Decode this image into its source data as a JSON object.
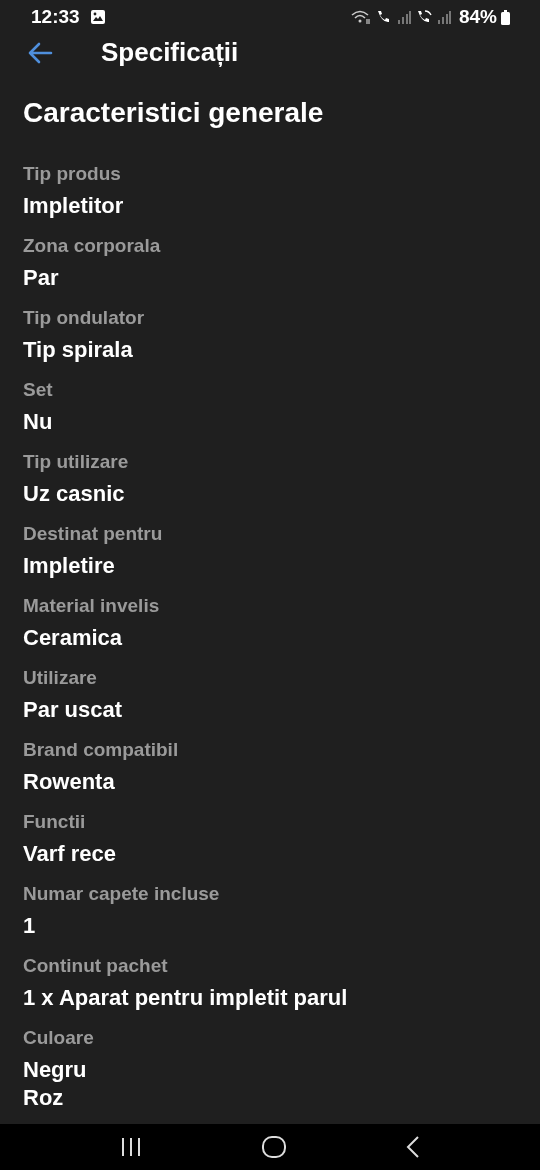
{
  "status_bar": {
    "time": "12:33",
    "battery": "84%"
  },
  "header": {
    "title": "Specificații"
  },
  "section": {
    "title": "Caracteristici generale"
  },
  "specs": [
    {
      "label": "Tip produs",
      "values": [
        "Impletitor"
      ]
    },
    {
      "label": "Zona corporala",
      "values": [
        "Par"
      ]
    },
    {
      "label": "Tip ondulator",
      "values": [
        "Tip spirala"
      ]
    },
    {
      "label": "Set",
      "values": [
        "Nu"
      ]
    },
    {
      "label": "Tip utilizare",
      "values": [
        "Uz casnic"
      ]
    },
    {
      "label": "Destinat pentru",
      "values": [
        "Impletire"
      ]
    },
    {
      "label": "Material invelis",
      "values": [
        "Ceramica"
      ]
    },
    {
      "label": "Utilizare",
      "values": [
        "Par uscat"
      ]
    },
    {
      "label": "Brand compatibil",
      "values": [
        "Rowenta"
      ]
    },
    {
      "label": "Functii",
      "values": [
        "Varf rece"
      ]
    },
    {
      "label": "Numar capete incluse",
      "values": [
        "1"
      ]
    },
    {
      "label": "Continut pachet",
      "values": [
        "1 x Aparat pentru impletit parul"
      ]
    },
    {
      "label": "Culoare",
      "values": [
        "Negru",
        "Roz"
      ]
    }
  ]
}
